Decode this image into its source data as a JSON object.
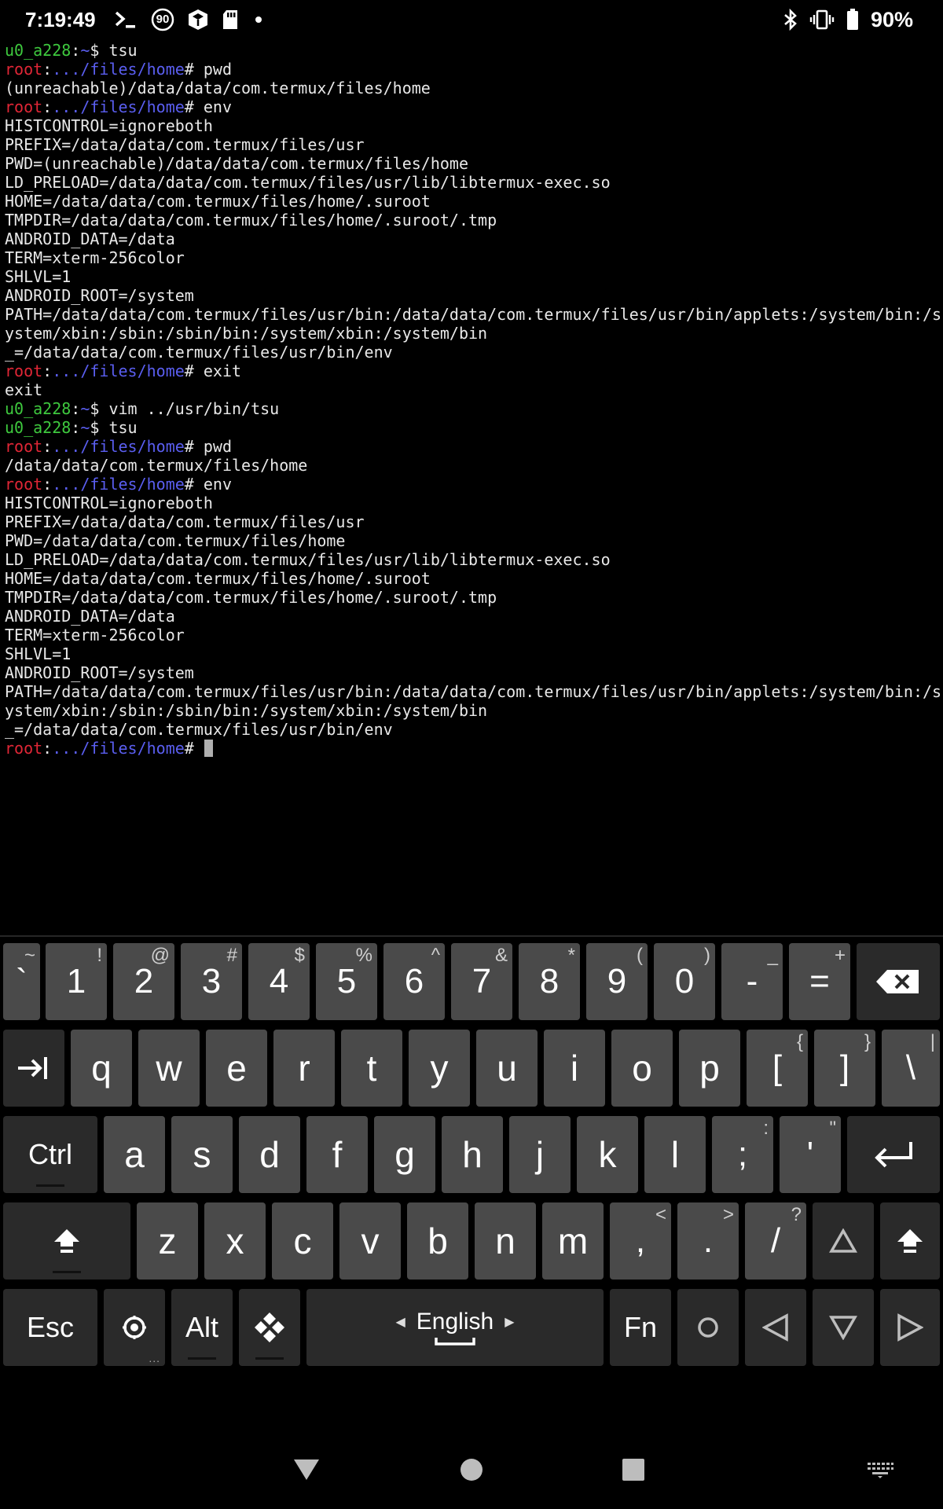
{
  "status_bar": {
    "time": "7:19:49",
    "badge_number": "90",
    "battery_text": "90%",
    "icons_left": [
      "terminal-icon",
      "badge-90-icon",
      "cube-icon",
      "sd-card-icon",
      "notification-dot-icon"
    ],
    "icons_right": [
      "bluetooth-icon",
      "vibrate-icon",
      "battery-icon"
    ]
  },
  "terminal": {
    "lines": [
      {
        "segments": [
          {
            "t": "u0_a228",
            "c": "user"
          },
          {
            "t": ":",
            "c": ""
          },
          {
            "t": "~",
            "c": "tilde"
          },
          {
            "t": "$ tsu",
            "c": ""
          }
        ]
      },
      {
        "segments": [
          {
            "t": "root",
            "c": "root"
          },
          {
            "t": ":",
            "c": ""
          },
          {
            "t": ".../files/home",
            "c": "path"
          },
          {
            "t": "# pwd",
            "c": ""
          }
        ]
      },
      {
        "segments": [
          {
            "t": "(unreachable)/data/data/com.termux/files/home",
            "c": ""
          }
        ]
      },
      {
        "segments": [
          {
            "t": "root",
            "c": "root"
          },
          {
            "t": ":",
            "c": ""
          },
          {
            "t": ".../files/home",
            "c": "path"
          },
          {
            "t": "# env",
            "c": ""
          }
        ]
      },
      {
        "segments": [
          {
            "t": "HISTCONTROL=ignoreboth",
            "c": ""
          }
        ]
      },
      {
        "segments": [
          {
            "t": "PREFIX=/data/data/com.termux/files/usr",
            "c": ""
          }
        ]
      },
      {
        "segments": [
          {
            "t": "PWD=(unreachable)/data/data/com.termux/files/home",
            "c": ""
          }
        ]
      },
      {
        "segments": [
          {
            "t": "LD_PRELOAD=/data/data/com.termux/files/usr/lib/libtermux-exec.so",
            "c": ""
          }
        ]
      },
      {
        "segments": [
          {
            "t": "HOME=/data/data/com.termux/files/home/.suroot",
            "c": ""
          }
        ]
      },
      {
        "segments": [
          {
            "t": "TMPDIR=/data/data/com.termux/files/home/.suroot/.tmp",
            "c": ""
          }
        ]
      },
      {
        "segments": [
          {
            "t": "ANDROID_DATA=/data",
            "c": ""
          }
        ]
      },
      {
        "segments": [
          {
            "t": "TERM=xterm-256color",
            "c": ""
          }
        ]
      },
      {
        "segments": [
          {
            "t": "SHLVL=1",
            "c": ""
          }
        ]
      },
      {
        "segments": [
          {
            "t": "ANDROID_ROOT=/system",
            "c": ""
          }
        ]
      },
      {
        "segments": [
          {
            "t": "PATH=/data/data/com.termux/files/usr/bin:/data/data/com.termux/files/usr/bin/applets:/system/bin:/s",
            "c": ""
          }
        ]
      },
      {
        "segments": [
          {
            "t": "ystem/xbin:/sbin:/sbin/bin:/system/xbin:/system/bin",
            "c": ""
          }
        ]
      },
      {
        "segments": [
          {
            "t": "_=/data/data/com.termux/files/usr/bin/env",
            "c": ""
          }
        ]
      },
      {
        "segments": [
          {
            "t": "root",
            "c": "root"
          },
          {
            "t": ":",
            "c": ""
          },
          {
            "t": ".../files/home",
            "c": "path"
          },
          {
            "t": "# exit",
            "c": ""
          }
        ]
      },
      {
        "segments": [
          {
            "t": "exit",
            "c": ""
          }
        ]
      },
      {
        "segments": [
          {
            "t": "u0_a228",
            "c": "user"
          },
          {
            "t": ":",
            "c": ""
          },
          {
            "t": "~",
            "c": "tilde"
          },
          {
            "t": "$ vim ../usr/bin/tsu",
            "c": ""
          }
        ]
      },
      {
        "segments": [
          {
            "t": "u0_a228",
            "c": "user"
          },
          {
            "t": ":",
            "c": ""
          },
          {
            "t": "~",
            "c": "tilde"
          },
          {
            "t": "$ tsu",
            "c": ""
          }
        ]
      },
      {
        "segments": [
          {
            "t": "root",
            "c": "root"
          },
          {
            "t": ":",
            "c": ""
          },
          {
            "t": ".../files/home",
            "c": "path"
          },
          {
            "t": "# pwd",
            "c": ""
          }
        ]
      },
      {
        "segments": [
          {
            "t": "/data/data/com.termux/files/home",
            "c": ""
          }
        ]
      },
      {
        "segments": [
          {
            "t": "root",
            "c": "root"
          },
          {
            "t": ":",
            "c": ""
          },
          {
            "t": ".../files/home",
            "c": "path"
          },
          {
            "t": "# env",
            "c": ""
          }
        ]
      },
      {
        "segments": [
          {
            "t": "HISTCONTROL=ignoreboth",
            "c": ""
          }
        ]
      },
      {
        "segments": [
          {
            "t": "PREFIX=/data/data/com.termux/files/usr",
            "c": ""
          }
        ]
      },
      {
        "segments": [
          {
            "t": "PWD=/data/data/com.termux/files/home",
            "c": ""
          }
        ]
      },
      {
        "segments": [
          {
            "t": "LD_PRELOAD=/data/data/com.termux/files/usr/lib/libtermux-exec.so",
            "c": ""
          }
        ]
      },
      {
        "segments": [
          {
            "t": "HOME=/data/data/com.termux/files/home/.suroot",
            "c": ""
          }
        ]
      },
      {
        "segments": [
          {
            "t": "TMPDIR=/data/data/com.termux/files/home/.suroot/.tmp",
            "c": ""
          }
        ]
      },
      {
        "segments": [
          {
            "t": "ANDROID_DATA=/data",
            "c": ""
          }
        ]
      },
      {
        "segments": [
          {
            "t": "TERM=xterm-256color",
            "c": ""
          }
        ]
      },
      {
        "segments": [
          {
            "t": "SHLVL=1",
            "c": ""
          }
        ]
      },
      {
        "segments": [
          {
            "t": "ANDROID_ROOT=/system",
            "c": ""
          }
        ]
      },
      {
        "segments": [
          {
            "t": "PATH=/data/data/com.termux/files/usr/bin:/data/data/com.termux/files/usr/bin/applets:/system/bin:/s",
            "c": ""
          }
        ]
      },
      {
        "segments": [
          {
            "t": "ystem/xbin:/sbin:/sbin/bin:/system/xbin:/system/bin",
            "c": ""
          }
        ]
      },
      {
        "segments": [
          {
            "t": "_=/data/data/com.termux/files/usr/bin/env",
            "c": ""
          }
        ]
      },
      {
        "segments": [
          {
            "t": "root",
            "c": "root"
          },
          {
            "t": ":",
            "c": ""
          },
          {
            "t": ".../files/home",
            "c": "path"
          },
          {
            "t": "# ",
            "c": ""
          }
        ],
        "cursor": true
      }
    ]
  },
  "keyboard": {
    "rows": [
      [
        {
          "label": "`",
          "hint": "~",
          "name": "key-backtick"
        },
        {
          "label": "1",
          "hint": "!",
          "name": "key-1"
        },
        {
          "label": "2",
          "hint": "@",
          "name": "key-2"
        },
        {
          "label": "3",
          "hint": "#",
          "name": "key-3"
        },
        {
          "label": "4",
          "hint": "$",
          "name": "key-4"
        },
        {
          "label": "5",
          "hint": "%",
          "name": "key-5"
        },
        {
          "label": "6",
          "hint": "^",
          "name": "key-6"
        },
        {
          "label": "7",
          "hint": "&",
          "name": "key-7"
        },
        {
          "label": "8",
          "hint": "*",
          "name": "key-8"
        },
        {
          "label": "9",
          "hint": "(",
          "name": "key-9"
        },
        {
          "label": "0",
          "hint": ")",
          "name": "key-0"
        },
        {
          "label": "-",
          "hint": "_",
          "name": "key-minus"
        },
        {
          "label": "=",
          "hint": "+",
          "name": "key-equals"
        },
        {
          "label": "",
          "icon": "backspace-icon",
          "name": "key-backspace",
          "dark": true
        }
      ],
      [
        {
          "label": "",
          "icon": "tab-icon",
          "name": "key-tab",
          "dark": true
        },
        {
          "label": "q",
          "name": "key-q"
        },
        {
          "label": "w",
          "name": "key-w"
        },
        {
          "label": "e",
          "name": "key-e"
        },
        {
          "label": "r",
          "name": "key-r"
        },
        {
          "label": "t",
          "name": "key-t"
        },
        {
          "label": "y",
          "name": "key-y"
        },
        {
          "label": "u",
          "name": "key-u"
        },
        {
          "label": "i",
          "name": "key-i"
        },
        {
          "label": "o",
          "name": "key-o"
        },
        {
          "label": "p",
          "name": "key-p"
        },
        {
          "label": "[",
          "hint": "{",
          "name": "key-left-bracket"
        },
        {
          "label": "]",
          "hint": "}",
          "name": "key-right-bracket"
        },
        {
          "label": "\\",
          "hint": "|",
          "name": "key-backslash"
        }
      ],
      [
        {
          "label": "Ctrl",
          "name": "key-ctrl",
          "dark": true,
          "word": true,
          "underline": true
        },
        {
          "label": "a",
          "name": "key-a"
        },
        {
          "label": "s",
          "name": "key-s"
        },
        {
          "label": "d",
          "name": "key-d"
        },
        {
          "label": "f",
          "name": "key-f"
        },
        {
          "label": "g",
          "name": "key-g"
        },
        {
          "label": "h",
          "name": "key-h"
        },
        {
          "label": "j",
          "name": "key-j"
        },
        {
          "label": "k",
          "name": "key-k"
        },
        {
          "label": "l",
          "name": "key-l"
        },
        {
          "label": ";",
          "hint": ":",
          "name": "key-semicolon"
        },
        {
          "label": "'",
          "hint": "\"",
          "name": "key-quote"
        },
        {
          "label": "",
          "icon": "enter-icon",
          "name": "key-enter",
          "dark": true
        }
      ],
      [
        {
          "label": "",
          "icon": "shift-icon",
          "name": "key-shift-left",
          "dark": true,
          "underline": true
        },
        {
          "label": "z",
          "name": "key-z"
        },
        {
          "label": "x",
          "name": "key-x"
        },
        {
          "label": "c",
          "name": "key-c"
        },
        {
          "label": "v",
          "name": "key-v"
        },
        {
          "label": "b",
          "name": "key-b"
        },
        {
          "label": "n",
          "name": "key-n"
        },
        {
          "label": "m",
          "name": "key-m"
        },
        {
          "label": ",",
          "hint": "<",
          "name": "key-comma"
        },
        {
          "label": ".",
          "hint": ">",
          "name": "key-period"
        },
        {
          "label": "/",
          "hint": "?",
          "name": "key-slash"
        },
        {
          "label": "",
          "icon": "up-arrow-icon",
          "name": "key-up",
          "dark": true
        },
        {
          "label": "",
          "icon": "shift-icon",
          "name": "key-shift-right",
          "dark": true
        }
      ],
      [
        {
          "label": "Esc",
          "name": "key-esc",
          "dark": true,
          "word": true
        },
        {
          "label": "",
          "icon": "settings-icon",
          "name": "key-settings",
          "dark": true,
          "dots": "..."
        },
        {
          "label": "Alt",
          "name": "key-alt",
          "dark": true,
          "word": true,
          "underline": true
        },
        {
          "label": "",
          "icon": "diamond-icon",
          "name": "key-meta",
          "dark": true,
          "underline": true
        },
        {
          "label": "English",
          "icon": "space-icon",
          "name": "key-space",
          "dark": true,
          "space": true
        },
        {
          "label": "Fn",
          "name": "key-fn",
          "dark": true,
          "word": true
        },
        {
          "label": "",
          "icon": "circle-icon",
          "name": "key-circle",
          "dark": true
        },
        {
          "label": "",
          "icon": "left-arrow-icon",
          "name": "key-left",
          "dark": true
        },
        {
          "label": "",
          "icon": "down-arrow-icon",
          "name": "key-down",
          "dark": true
        },
        {
          "label": "",
          "icon": "right-arrow-icon",
          "name": "key-right",
          "dark": true
        }
      ]
    ]
  },
  "nav_bar": {
    "icons": [
      "back-icon",
      "home-icon",
      "recents-icon",
      "keyboard-switch-icon"
    ]
  },
  "colors": {
    "user": "#3ec93e",
    "root": "#e02636",
    "path": "#5a5ef0",
    "key": "#4a4a4a",
    "key_dark": "#2a2a2a"
  }
}
